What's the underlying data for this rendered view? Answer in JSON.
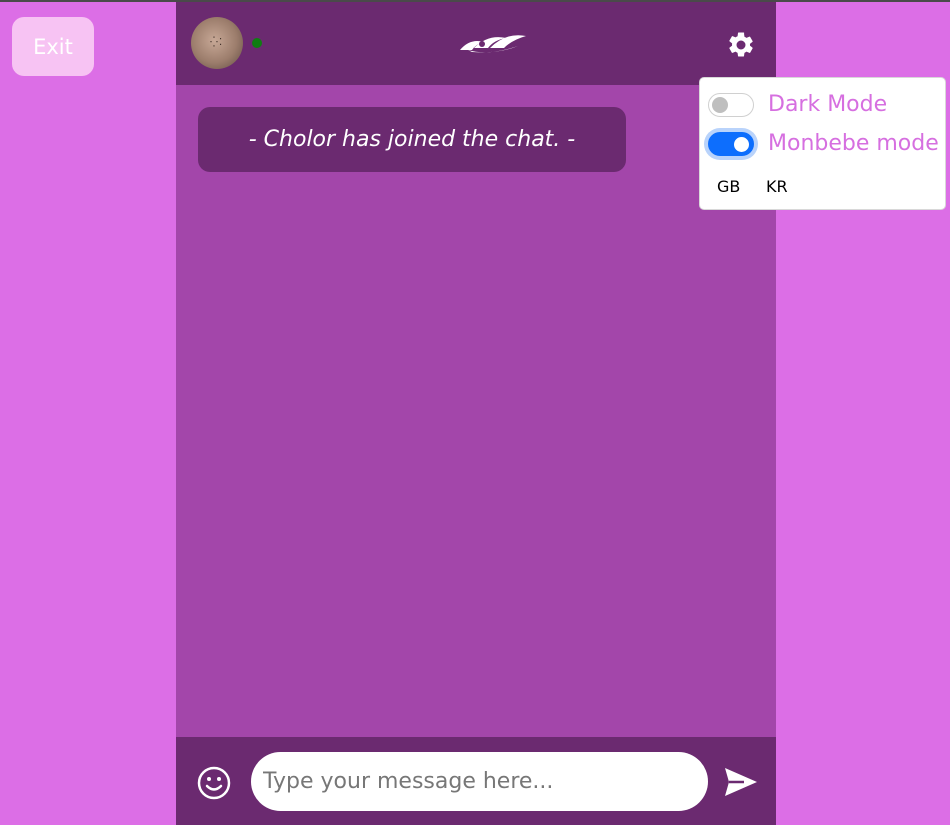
{
  "page": {
    "exit_label": "Exit"
  },
  "chat": {
    "system_message": "- Cholor has joined the chat. -",
    "input_placeholder": "Type your message here...",
    "online_status_color": "#0f7d12"
  },
  "settings": {
    "dark_mode_label": "Dark Mode",
    "dark_mode_enabled": false,
    "monbebe_mode_label": "Monbebe mode",
    "monbebe_mode_enabled": true,
    "languages": [
      "GB",
      "KR"
    ]
  },
  "icons": {
    "avatar": "user-avatar-photo",
    "logo": "monsta-x-logo",
    "settings": "gear-icon",
    "emoji": "smiley-icon",
    "send": "paper-plane-icon"
  },
  "colors": {
    "page_background": "#dc6ee6",
    "chat_background": "#a346aa",
    "header_footer": "#6b2a70",
    "exit_button": "#f7c3f3",
    "toggle_accent": "#0d6efd",
    "settings_label": "#d66fe0"
  }
}
